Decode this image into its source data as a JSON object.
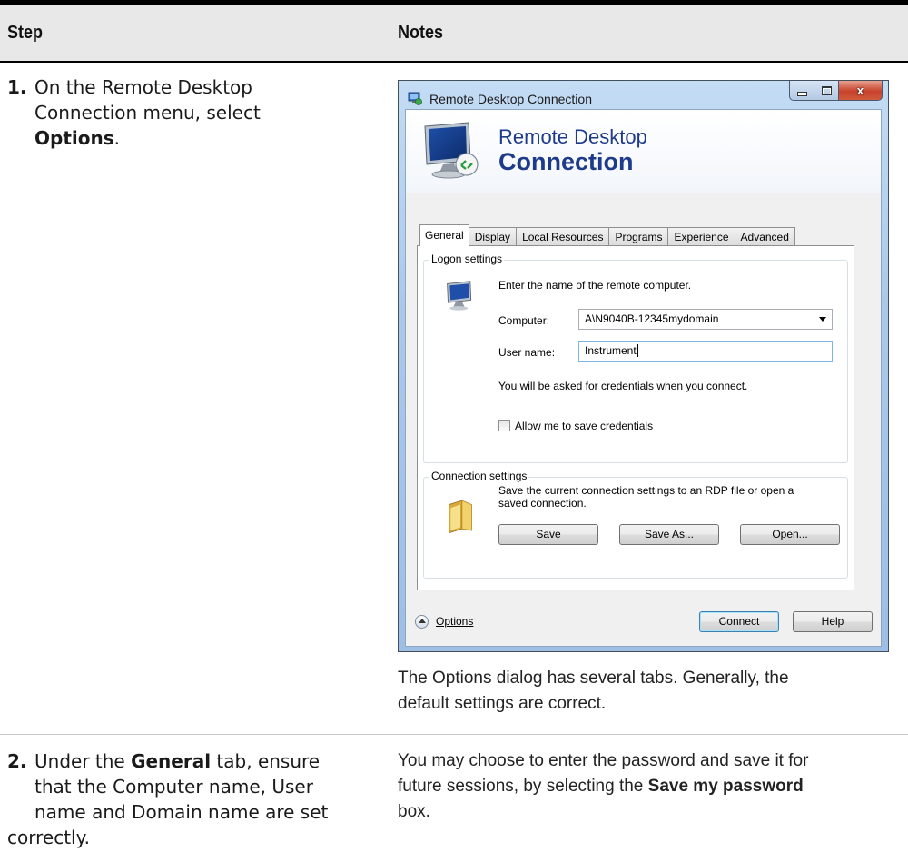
{
  "table": {
    "header": {
      "step": "Step",
      "notes": "Notes"
    },
    "rows": [
      {
        "number": "1.",
        "lines": [
          "On the Remote Desktop",
          "Connection menu, select"
        ],
        "bold_word": "Options",
        "bold_suffix": ".",
        "note_lines": [
          "The Options dialog has several tabs. Generally, the",
          "default settings are correct."
        ]
      },
      {
        "number": "2.",
        "line1_prefix": "Under the ",
        "line1_bold": "General",
        "line1_suffix": " tab, ensure",
        "lines": [
          "that the Computer name, User",
          "name and Domain name are set",
          "correctly."
        ],
        "note_line1": "You may choose to enter the password and save it for",
        "note_line2_prefix": "future sessions, by selecting the ",
        "note_line2_bold": "Save my password",
        "note_line3": "box."
      }
    ]
  },
  "dialog": {
    "title": "Remote Desktop Connection",
    "banner_line1": "Remote Desktop",
    "banner_line2": "Connection",
    "tabs": [
      "General",
      "Display",
      "Local Resources",
      "Programs",
      "Experience",
      "Advanced"
    ],
    "logon": {
      "group_label": "Logon settings",
      "instruction": "Enter the name of the remote computer.",
      "computer_label": "Computer:",
      "computer_value": "A\\N9040B-12345mydomain",
      "user_label": "User name:",
      "user_value": "Instrument",
      "credentials_note": "You will be asked for credentials when you connect.",
      "allow_save_label": "Allow me to save credentials"
    },
    "connection": {
      "group_label": "Connection settings",
      "description_line1": "Save the current connection settings to an RDP file or open a",
      "description_line2": "saved connection.",
      "save": "Save",
      "save_as": "Save As...",
      "open": "Open..."
    },
    "footer": {
      "options": "Options",
      "connect": "Connect",
      "help": "Help"
    },
    "caption_close": "x"
  }
}
